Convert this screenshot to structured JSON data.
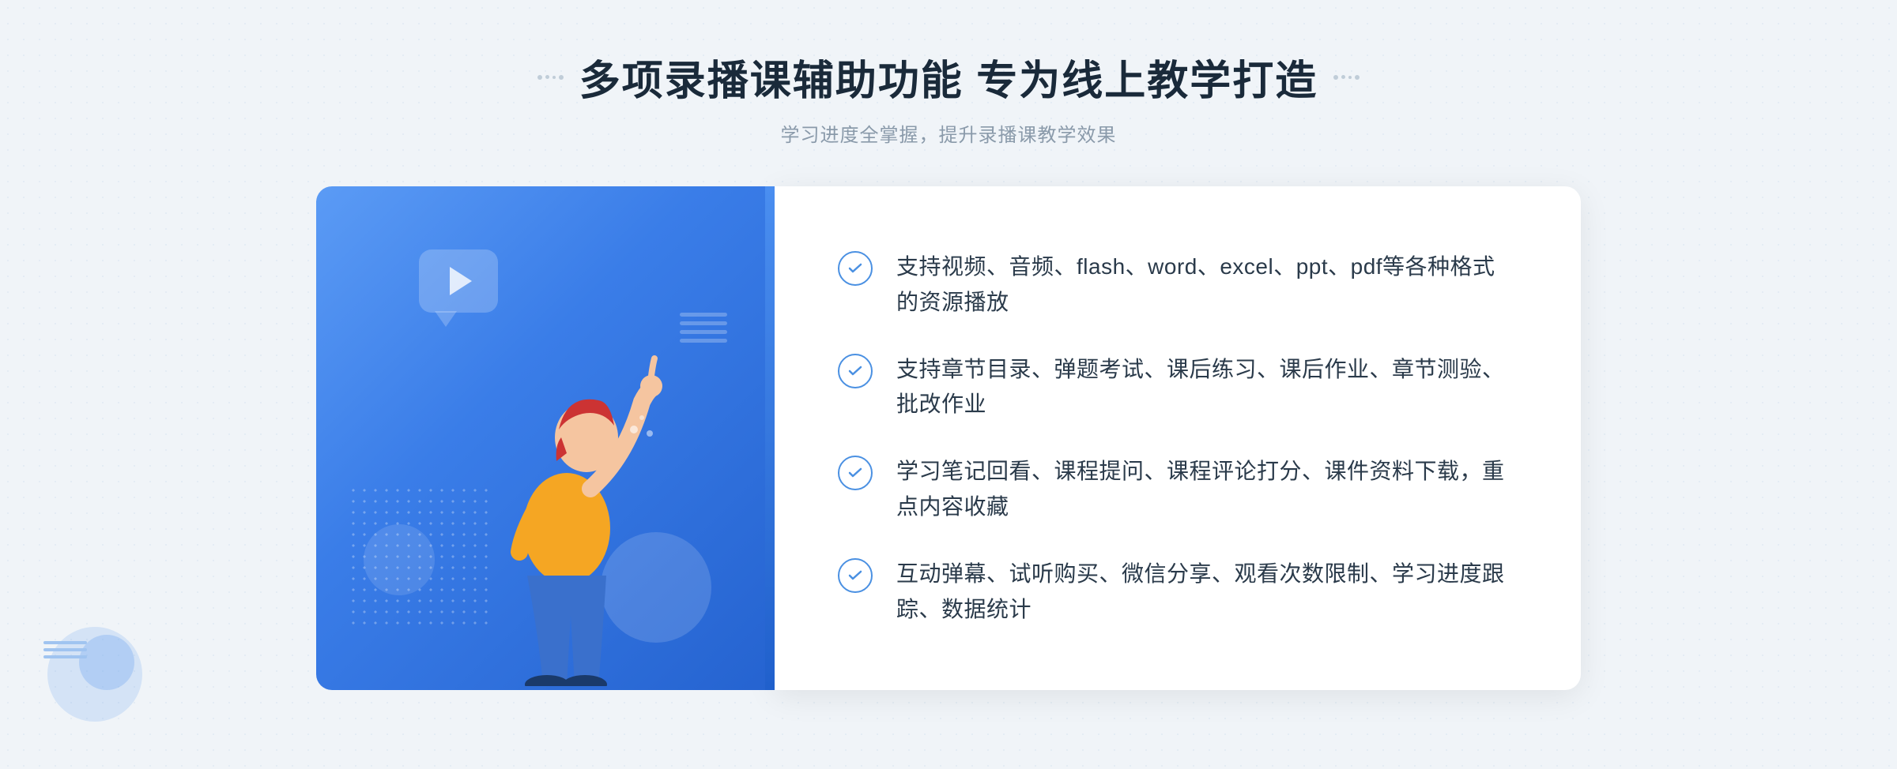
{
  "header": {
    "title": "多项录播课辅助功能 专为线上教学打造",
    "subtitle": "学习进度全掌握，提升录播课教学效果"
  },
  "features": [
    {
      "id": "feature-1",
      "text": "支持视频、音频、flash、word、excel、ppt、pdf等各种格式的资源播放"
    },
    {
      "id": "feature-2",
      "text": "支持章节目录、弹题考试、课后练习、课后作业、章节测验、批改作业"
    },
    {
      "id": "feature-3",
      "text": "学习笔记回看、课程提问、课程评论打分、课件资料下载，重点内容收藏"
    },
    {
      "id": "feature-4",
      "text": "互动弹幕、试听购买、微信分享、观看次数限制、学习进度跟踪、数据统计"
    }
  ],
  "decorations": {
    "left_arrow": "»"
  }
}
